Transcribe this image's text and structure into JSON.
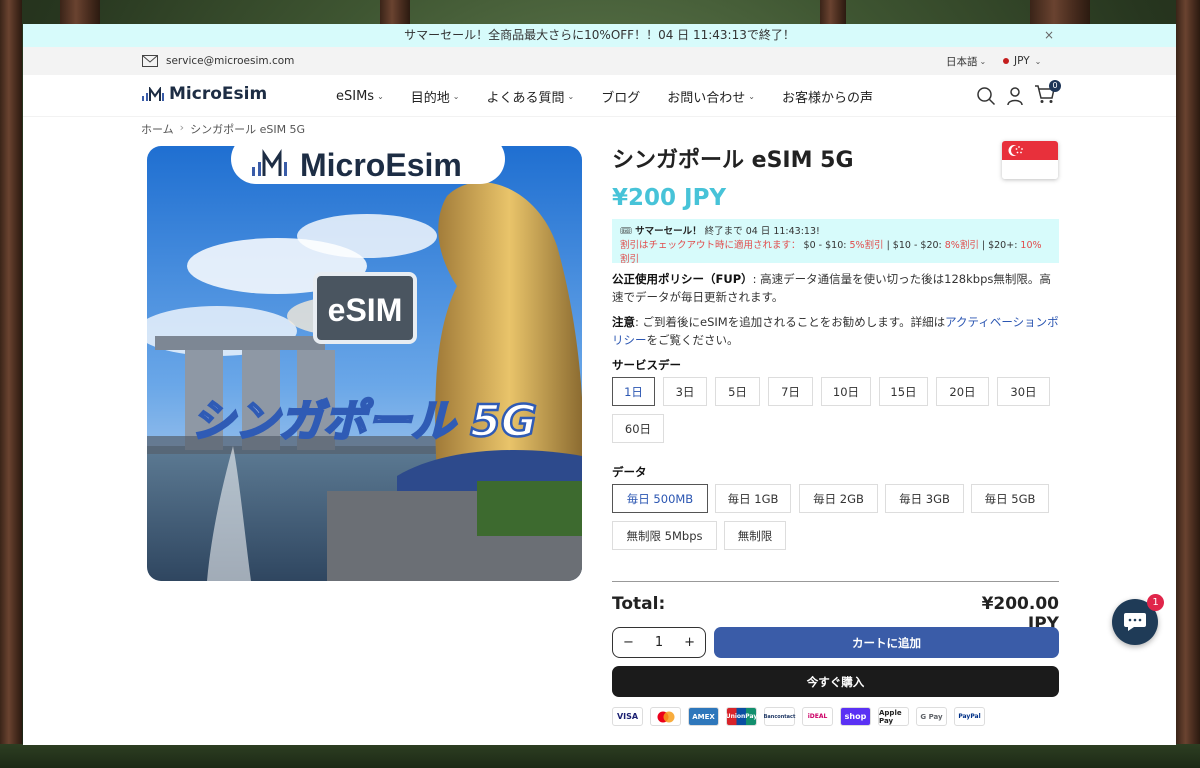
{
  "promo": {
    "text": "サマーセール！全商品最大さらに10%OFF！！04 日 11:43:13で終了！",
    "close": "×"
  },
  "topbar": {
    "email": "service@microesim.com",
    "language": "日本語",
    "currency": "JPY"
  },
  "nav": {
    "logo": "MicroEsim",
    "items": [
      {
        "label": "eSIMs",
        "has_dropdown": true
      },
      {
        "label": "目的地",
        "has_dropdown": true
      },
      {
        "label": "よくある質問",
        "has_dropdown": true
      },
      {
        "label": "ブログ",
        "has_dropdown": false
      },
      {
        "label": "お問い合わせ",
        "has_dropdown": true
      },
      {
        "label": "お客様からの声",
        "has_dropdown": false
      }
    ],
    "cart_count": "0"
  },
  "breadcrumb": {
    "home": "ホーム",
    "sep": "›",
    "current": "シンガポール eSIM 5G"
  },
  "product_image": {
    "logo": "MicroEsim",
    "badge": "eSIM",
    "caption": "シンガポール 5G"
  },
  "product": {
    "title": "シンガポール eSIM 5G",
    "price": "¥200 JPY",
    "sale": {
      "title": "サマーセール！",
      "ends_prefix": "終了まで",
      "ends_time": "04 日 11:43:13",
      "ends_suffix": "!",
      "line2_prefix": "割引はチェックアウト時に適用されます：",
      "tier1": "$0 - $10:",
      "tier1_val": "5%割引",
      "tier2": "| $10 - $20:",
      "tier2_val": "8%割引",
      "tier3": "| $20+:",
      "tier3_val": "10%割引"
    },
    "fup_label": "公正使用ポリシー（FUP）",
    "fup_text": ": 高速データ通信量を使い切った後は128kbps無制限。高速でデータが毎日更新されます。",
    "note_label": "注意",
    "note_text": ": ご到着後にeSIMを追加されることをお勧めします。詳細は",
    "note_link": "アクティベーションポリシー",
    "note_tail": "をご覧ください。",
    "days_label": "サービスデー",
    "days": [
      "1日",
      "3日",
      "5日",
      "7日",
      "10日",
      "15日",
      "20日",
      "30日",
      "60日"
    ],
    "days_selected": "1日",
    "data_label": "データ",
    "data_options": [
      "毎日 500MB",
      "毎日 1GB",
      "毎日 2GB",
      "毎日 3GB",
      "毎日 5GB",
      "無制限 5Mbps",
      "無制限"
    ],
    "data_selected": "毎日 500MB",
    "total_label": "Total:",
    "total_value": "¥200.00 JPY",
    "qty": "1",
    "qty_minus": "−",
    "qty_plus": "+",
    "add_to_cart": "カートに追加",
    "buy_now": "今すぐ購入"
  },
  "payments": [
    "VISA",
    "MC",
    "AMEX",
    "UnionPay",
    "Bancontact",
    "iDEAL",
    "shop",
    "Apple Pay",
    "G Pay",
    "PayPal"
  ],
  "chat": {
    "badge": "1"
  },
  "colors": {
    "accent": "#47c3d8",
    "primary_button": "#3a5ca8",
    "buy_button": "#1b1b1b",
    "promo_bg": "#d7fbfb",
    "sale_red": "#e14b4b"
  }
}
